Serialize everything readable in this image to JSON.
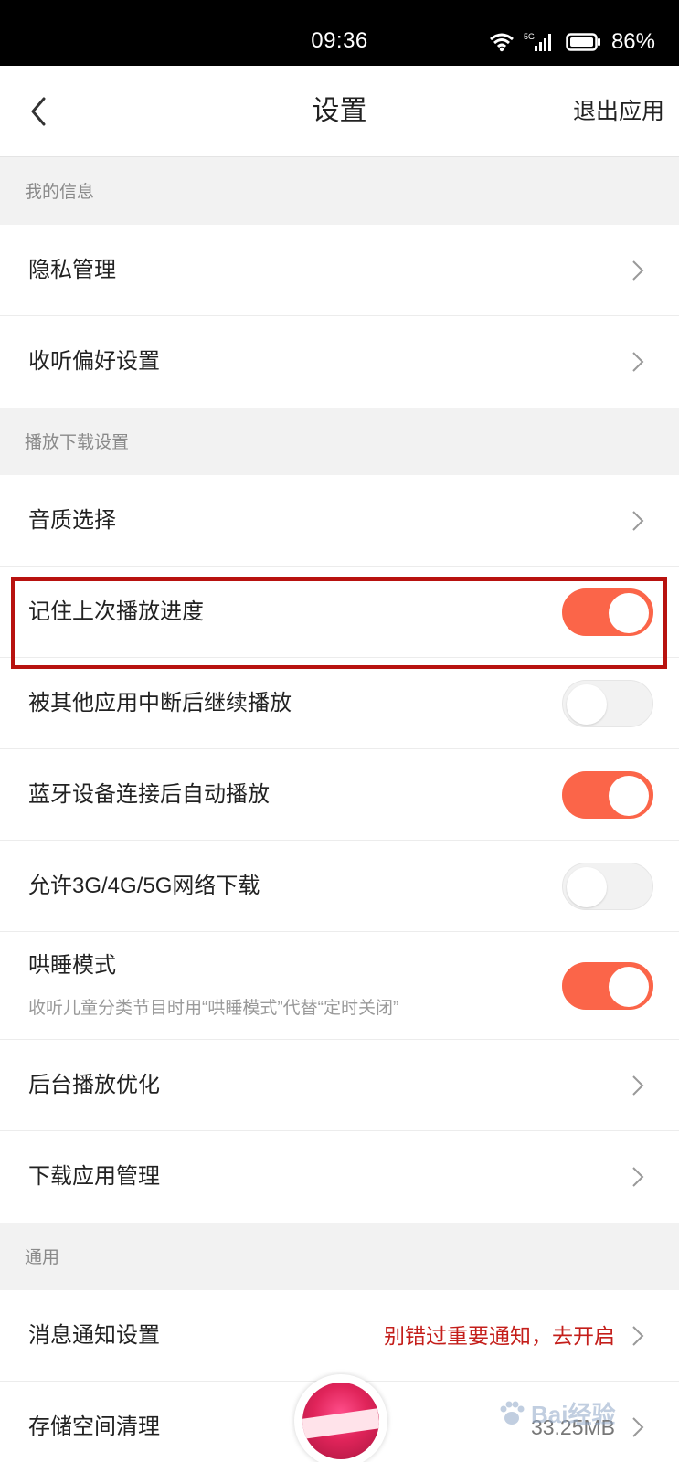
{
  "status_bar": {
    "time": "09:36",
    "network": "5G",
    "battery_percent": "86%",
    "icons": [
      "wifi-icon",
      "signal-icon",
      "battery-icon"
    ]
  },
  "header": {
    "title": "设置",
    "exit_label": "退出应用",
    "back_icon": "chevron-left-icon"
  },
  "sections": {
    "my_info": {
      "title": "我的信息",
      "items": [
        {
          "label": "隐私管理"
        },
        {
          "label": "收听偏好设置"
        }
      ]
    },
    "playback": {
      "title": "播放下载设置",
      "items": [
        {
          "label": "音质选择",
          "type": "link"
        },
        {
          "label": "记住上次播放进度",
          "type": "toggle",
          "on": true,
          "highlighted": true
        },
        {
          "label": "被其他应用中断后继续播放",
          "type": "toggle",
          "on": false
        },
        {
          "label": "蓝牙设备连接后自动播放",
          "type": "toggle",
          "on": true
        },
        {
          "label": "允许3G/4G/5G网络下载",
          "type": "toggle",
          "on": false
        },
        {
          "label": "哄睡模式",
          "sub": "收听儿童分类节目时用“哄睡模式”代替“定时关闭”",
          "type": "toggle",
          "on": true
        },
        {
          "label": "后台播放优化",
          "type": "link"
        },
        {
          "label": "下载应用管理",
          "type": "link"
        }
      ]
    },
    "general": {
      "title": "通用",
      "items": [
        {
          "label": "消息通知设置",
          "value": "别错过重要通知，去开启",
          "type": "link"
        },
        {
          "label": "存储空间清理",
          "value": "33.25MB",
          "type": "link"
        }
      ]
    }
  },
  "colors": {
    "accent": "#fb6549",
    "highlight_border": "#b8120f",
    "notice_red": "#c41e1a"
  },
  "watermark": "Bai经验"
}
